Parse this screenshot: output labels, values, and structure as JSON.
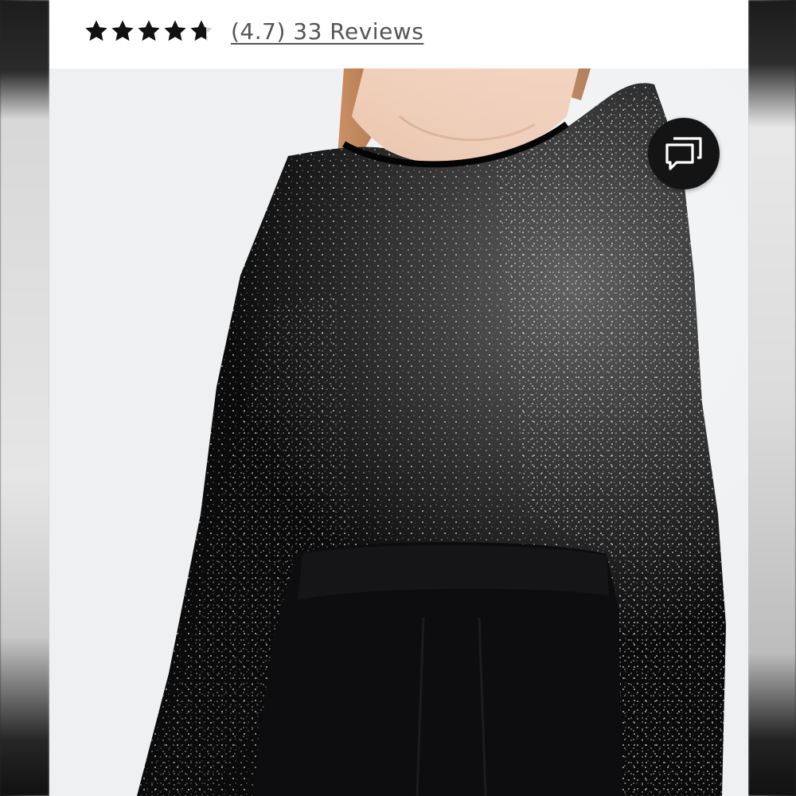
{
  "rating": {
    "stars_value": 4.7,
    "stars_max": 5,
    "link_text": "(4.7) 33 Reviews"
  },
  "product_image": {
    "alt": "Black sequin long sleeve top"
  },
  "chat": {
    "icon": "chat-bubbles-icon"
  },
  "colors": {
    "star": "#111111",
    "star_empty": "#cfcfcf",
    "link": "#555555",
    "chat_bg": "#141414"
  }
}
